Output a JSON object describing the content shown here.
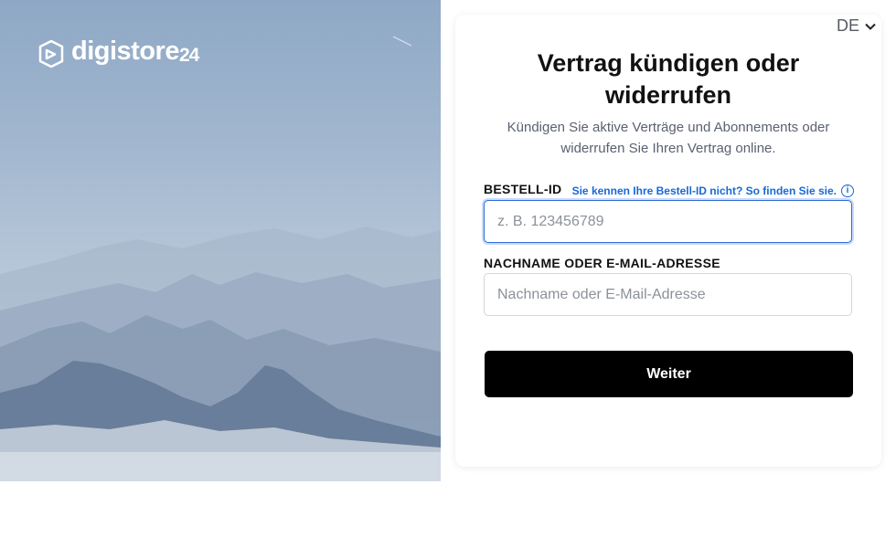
{
  "brand": {
    "name": "digistore",
    "suffix": "24"
  },
  "language": {
    "current": "DE"
  },
  "form": {
    "title": "Vertrag kündigen oder widerrufen",
    "subtitle": "Kündigen Sie aktive Verträge und Abonnements oder widerrufen Sie Ihren Vertrag online.",
    "order_id_label": "BESTELL-ID",
    "order_id_help": "Sie kennen Ihre Bestell-ID nicht? So finden Sie sie.",
    "order_id_placeholder": "z. B. 123456789",
    "order_id_value": "",
    "name_label": "NACHNAME ODER E-MAIL-ADRESSE",
    "name_placeholder": "Nachname oder E-Mail-Adresse",
    "name_value": "",
    "submit_label": "Weiter"
  },
  "icons": {
    "logo": "digistore-logo-icon",
    "chevron": "chevron-down-icon",
    "info": "info-icon"
  },
  "colors": {
    "accent": "#1769d6",
    "button": "#000000",
    "focus": "#2f6bd8"
  }
}
